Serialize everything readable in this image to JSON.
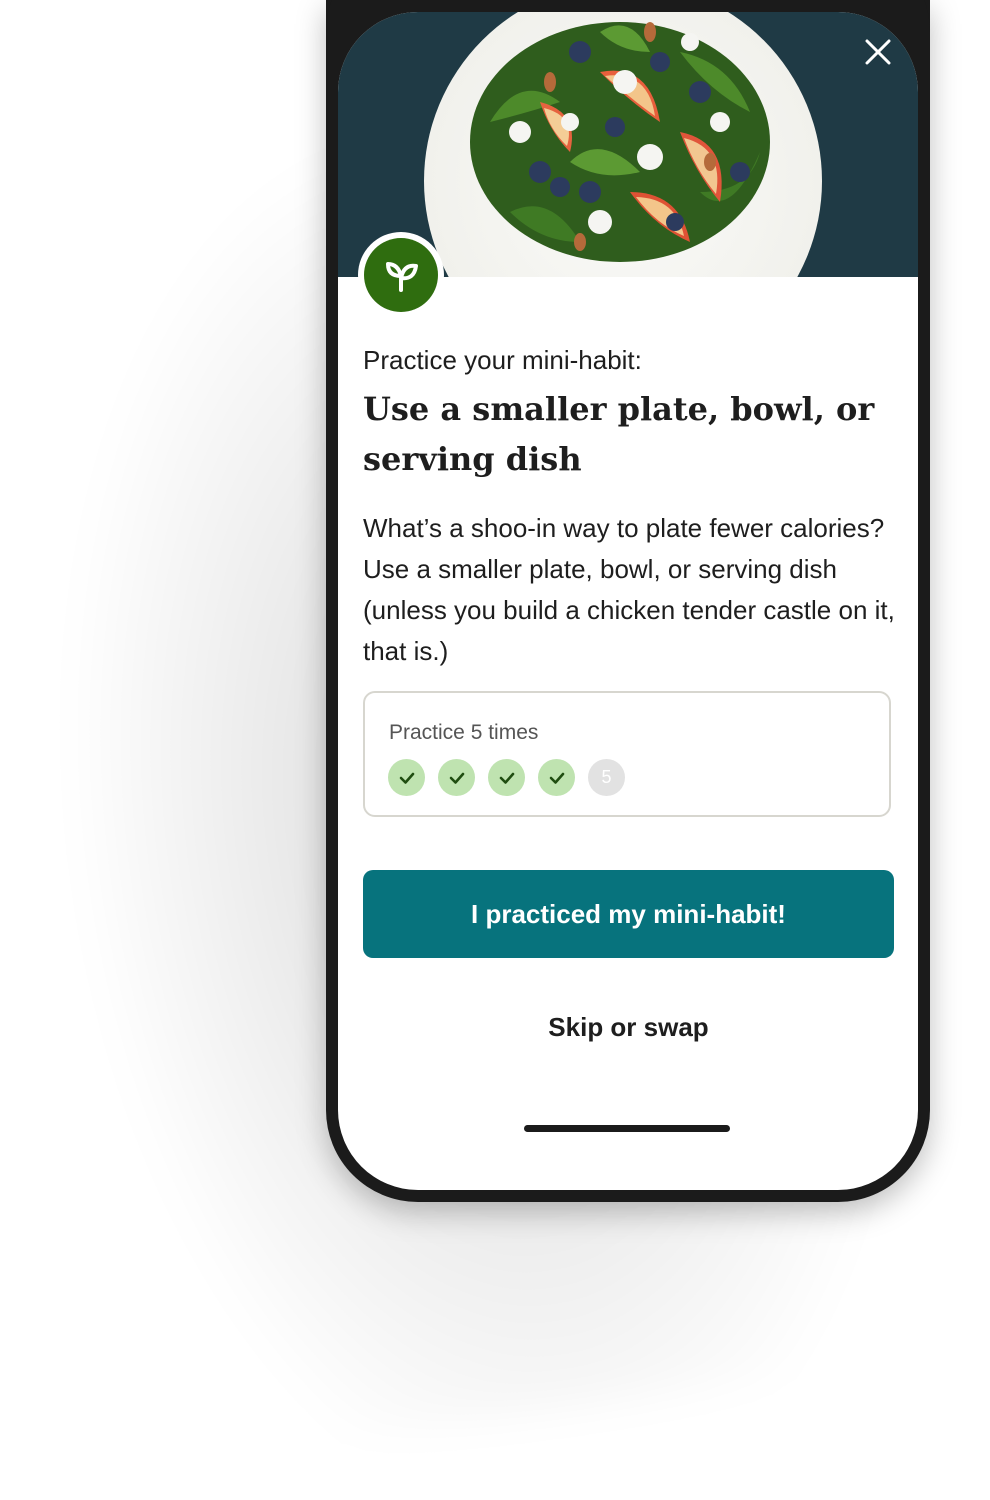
{
  "hero": {
    "image_icon": "salad-plate-icon",
    "close_icon": "close-icon"
  },
  "badge": {
    "icon": "sprout-icon",
    "color": "#2f6d0f"
  },
  "habit": {
    "kicker": "Practice your mini-habit:",
    "title_line1": "Use a smaller plate, bowl, or",
    "title_line2": "serving dish",
    "description": "What’s a shoo-in way to plate fewer calories? Use a smaller plate, bowl, or serving dish (unless you build a chicken tender castle on it, that is.)"
  },
  "progress": {
    "label": "Practice 5 times",
    "completed": 4,
    "total": 5,
    "pending_label": "5",
    "done_color": "#bfe3b0",
    "pending_color": "#e2e2e2"
  },
  "actions": {
    "primary_label": "I practiced my mini-habit!",
    "secondary_label": "Skip or swap",
    "primary_color": "#07737d"
  },
  "colors": {
    "hero_bg": "#1f3a45"
  }
}
